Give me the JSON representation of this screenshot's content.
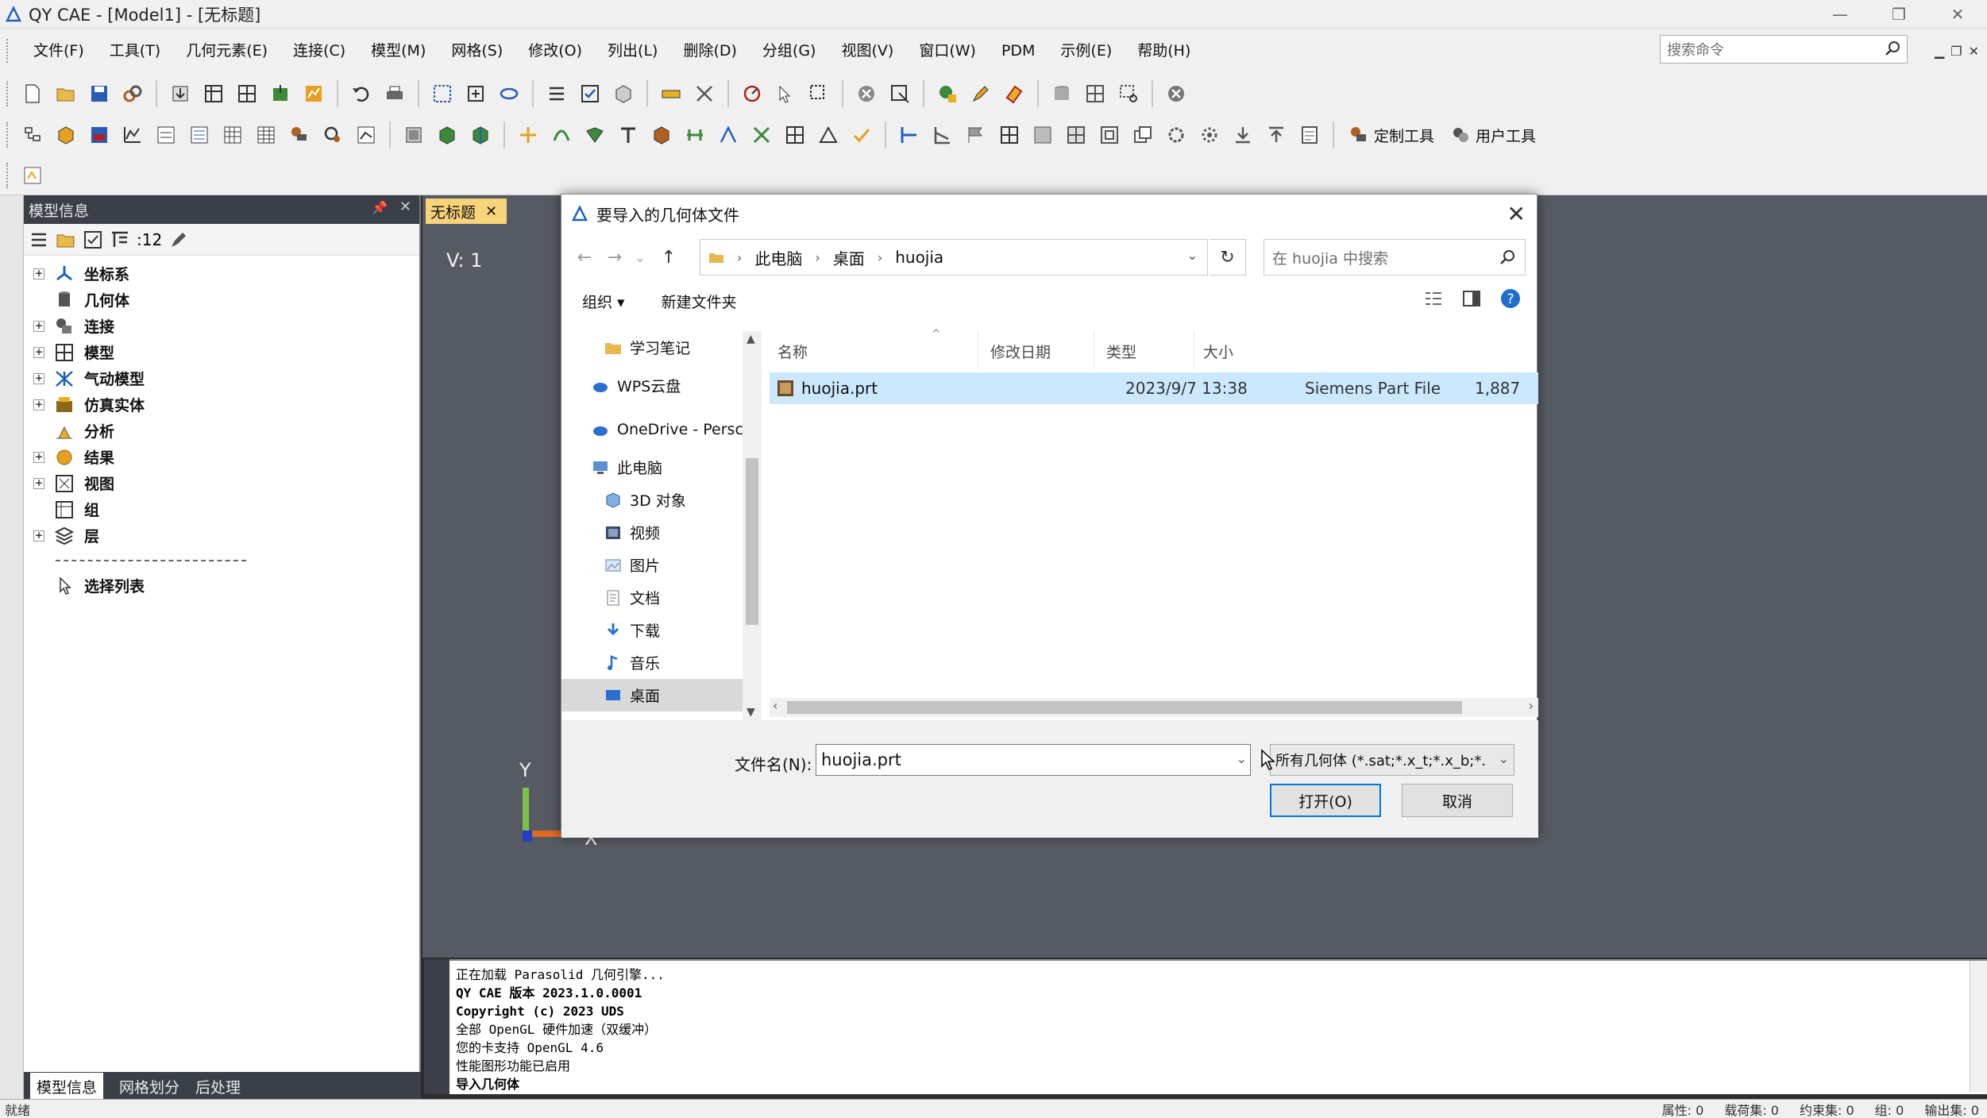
{
  "window": {
    "title": "QY CAE - [Model1] - [无标题]"
  },
  "menu": {
    "items": [
      "文件(F)",
      "工具(T)",
      "几何元素(E)",
      "连接(C)",
      "模型(M)",
      "网格(S)",
      "修改(O)",
      "列出(L)",
      "删除(D)",
      "分组(G)",
      "视图(V)",
      "窗口(W)",
      "PDM",
      "示例(E)",
      "帮助(H)"
    ],
    "search_placeholder": "搜索命令"
  },
  "toolbar": {
    "custom_tools": "定制工具",
    "user_tools": "用户工具"
  },
  "model_panel": {
    "title": "模型信息",
    "count_label": ":12",
    "tree": [
      {
        "label": "坐标系",
        "expandable": true
      },
      {
        "label": "几何体",
        "expandable": false
      },
      {
        "label": "连接",
        "expandable": true
      },
      {
        "label": "模型",
        "expandable": true
      },
      {
        "label": "气动模型",
        "expandable": true
      },
      {
        "label": "仿真实体",
        "expandable": true
      },
      {
        "label": "分析",
        "expandable": false
      },
      {
        "label": "结果",
        "expandable": true
      },
      {
        "label": "视图",
        "expandable": true
      },
      {
        "label": "组",
        "expandable": false
      },
      {
        "label": "层",
        "expandable": true
      }
    ],
    "selection_list": "选择列表",
    "tabs": [
      "模型信息",
      "网格划分",
      "后处理"
    ]
  },
  "document_tab": {
    "label": "无标题"
  },
  "viewport": {
    "view_label": "V: 1",
    "axis_y": "Y",
    "axis_x": "X"
  },
  "console": {
    "lines": [
      "正在加载 Parasolid 几何引擎...",
      "QY CAE 版本 2023.1.0.0001",
      "Copyright (c) 2023 UDS",
      "全部 OpenGL 硬件加速（双缓冲）",
      "您的卡支持 OpenGL 4.6",
      "性能图形功能已启用",
      "导入几何体"
    ]
  },
  "statusbar": {
    "ready": "就绪",
    "items": [
      "属性: 0",
      "载荷集: 0",
      "约束集: 0",
      "组: 0",
      "输出集: 0"
    ]
  },
  "dialog": {
    "title": "要导入的几何体文件",
    "breadcrumb": [
      "此电脑",
      "桌面",
      "huojia"
    ],
    "search_placeholder": "在 huojia 中搜索",
    "organize": "组织 ▾",
    "new_folder": "新建文件夹",
    "nav_items": [
      {
        "label": "学习笔记",
        "icon": "folder-icon",
        "indent": 2,
        "selected": false
      },
      {
        "label": "WPS云盘",
        "icon": "cloud-icon",
        "indent": 1,
        "selected": false
      },
      {
        "label": "OneDrive - Persc",
        "icon": "cloud-icon",
        "indent": 1,
        "selected": false
      },
      {
        "label": "此电脑",
        "icon": "computer-icon",
        "indent": 1,
        "selected": false
      },
      {
        "label": "3D 对象",
        "icon": "cube-icon",
        "indent": 2,
        "selected": false
      },
      {
        "label": "视频",
        "icon": "video-icon",
        "indent": 2,
        "selected": false
      },
      {
        "label": "图片",
        "icon": "picture-icon",
        "indent": 2,
        "selected": false
      },
      {
        "label": "文档",
        "icon": "document-icon",
        "indent": 2,
        "selected": false
      },
      {
        "label": "下载",
        "icon": "download-icon",
        "indent": 2,
        "selected": false
      },
      {
        "label": "音乐",
        "icon": "music-icon",
        "indent": 2,
        "selected": false
      },
      {
        "label": "桌面",
        "icon": "desktop-icon",
        "indent": 2,
        "selected": true
      }
    ],
    "columns": [
      "名称",
      "修改日期",
      "类型",
      "大小"
    ],
    "files": [
      {
        "name": "huojia.prt",
        "modified": "2023/9/7 13:38",
        "type": "Siemens Part File",
        "size": "1,887"
      }
    ],
    "filename_label": "文件名(N):",
    "filename_value": "huojia.prt",
    "filetype_value": "所有几何体 (*.sat;*.x_t;*.x_b;*.",
    "open_button": "打开(O)",
    "cancel_button": "取消"
  },
  "colors": {
    "viewport_bg": "#565a62",
    "panel_header": "#3b3f48",
    "selection": "#cce8ff",
    "accent": "#0078d7",
    "doc_tab": "#f7d37a"
  }
}
